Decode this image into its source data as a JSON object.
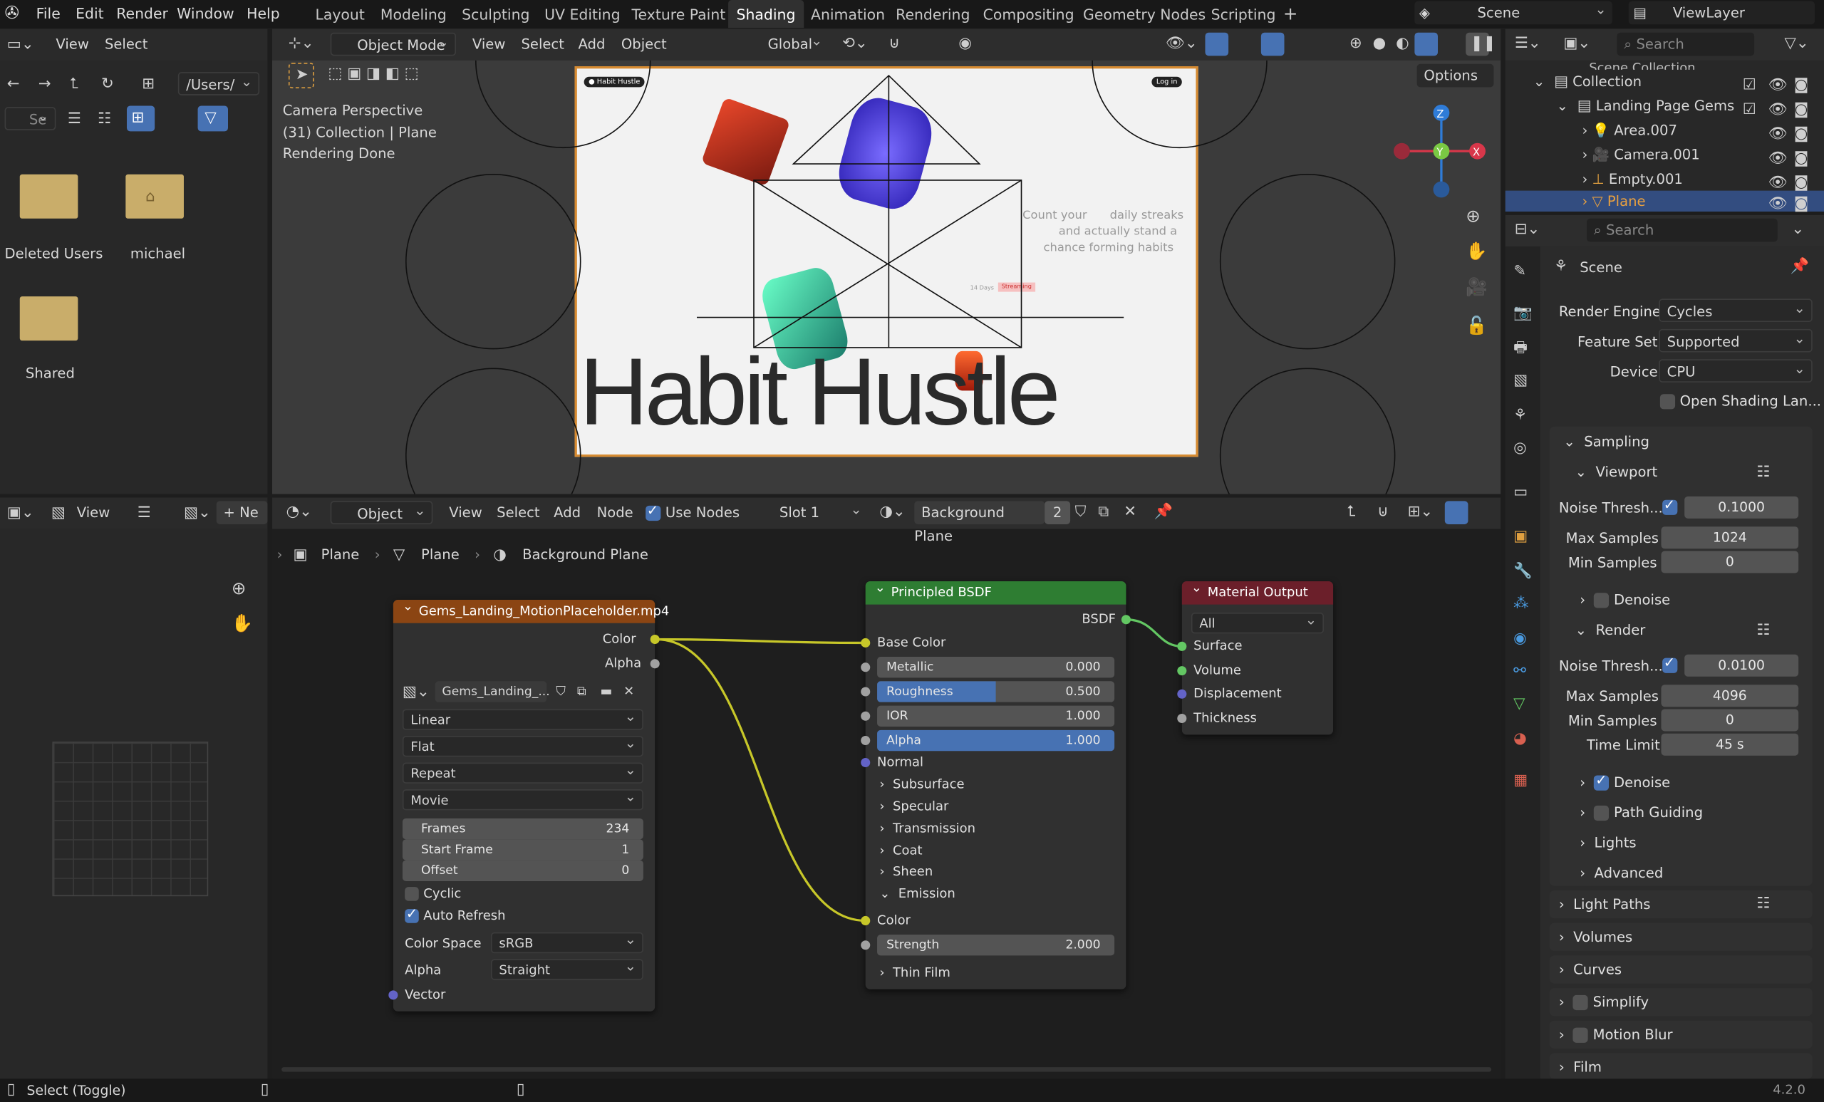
{
  "menu": {
    "file": "File",
    "edit": "Edit",
    "render": "Render",
    "window": "Window",
    "help": "Help"
  },
  "workspaces": [
    "Layout",
    "Modeling",
    "Sculpting",
    "UV Editing",
    "Texture Paint",
    "Shading",
    "Animation",
    "Rendering",
    "Compositing",
    "Geometry Nodes",
    "Scripting",
    "+"
  ],
  "active_workspace": "Shading",
  "scene_name": "Scene",
  "view_layer": "ViewLayer",
  "filebrowser": {
    "view": "View",
    "select": "Select",
    "path": "/Users/",
    "search_placeholder": "Se",
    "items": [
      {
        "name": "Deleted Users"
      },
      {
        "name": "michael"
      },
      {
        "name": "Shared"
      }
    ]
  },
  "viewport": {
    "mode": "Object Mode",
    "view": "View",
    "select": "Select",
    "add": "Add",
    "object": "Object",
    "orientation": "Global",
    "options": "Options",
    "info_line1": "Camera Perspective",
    "info_line2": "(31) Collection | Plane",
    "info_line3": "Rendering Done",
    "render_title": "Habit Hustle",
    "render_tagline_1": "Count your",
    "render_tagline_2": "daily streaks",
    "render_tagline_3": "and actually stand a",
    "render_tagline_4": "chance forming habits",
    "render_badge": "● Habit Hustle",
    "render_login": "Log in",
    "render_pill": "Streaming",
    "render_small": "14 Days",
    "gizmo_z": "Z",
    "gizmo_y": "Y",
    "gizmo_x": "X"
  },
  "image_editor": {
    "view": "View",
    "new": "Ne"
  },
  "node_editor": {
    "object": "Object",
    "view": "View",
    "select": "Select",
    "add": "Add",
    "node": "Node",
    "use_nodes": "Use Nodes",
    "slot": "Slot 1",
    "material": "Background Plane",
    "users": "2",
    "breadcrumb": [
      "Plane",
      "Plane",
      "Background Plane"
    ]
  },
  "image_node": {
    "title": "Gems_Landing_MotionPlaceholder.mp4",
    "out_color": "Color",
    "out_alpha": "Alpha",
    "image_name": "Gems_Landing_...",
    "interpolation": "Linear",
    "projection": "Flat",
    "extension": "Repeat",
    "source": "Movie",
    "frames_label": "Frames",
    "frames": "234",
    "start_label": "Start Frame",
    "start": "1",
    "offset_label": "Offset",
    "offset": "0",
    "cyclic": "Cyclic",
    "auto_refresh": "Auto Refresh",
    "color_space_label": "Color Space",
    "color_space": "sRGB",
    "alpha_label": "Alpha",
    "alpha": "Straight",
    "vector": "Vector"
  },
  "bsdf_node": {
    "title": "Principled BSDF",
    "out": "BSDF",
    "base_color": "Base Color",
    "metallic_label": "Metallic",
    "metallic": "0.000",
    "roughness_label": "Roughness",
    "roughness": "0.500",
    "roughness_fill": 0.5,
    "ior_label": "IOR",
    "ior": "1.000",
    "alpha_label": "Alpha",
    "alpha": "1.000",
    "normal": "Normal",
    "subsurface": "Subsurface",
    "specular": "Specular",
    "transmission": "Transmission",
    "coat": "Coat",
    "sheen": "Sheen",
    "emission": "Emission",
    "emission_color": "Color",
    "strength_label": "Strength",
    "strength": "2.000",
    "thin_film": "Thin Film"
  },
  "output_node": {
    "title": "Material Output",
    "target": "All",
    "surface": "Surface",
    "volume": "Volume",
    "displacement": "Displacement",
    "thickness": "Thickness"
  },
  "outliner": {
    "search": "Search",
    "scene_collection": "Scene Collection",
    "collection": "Collection",
    "landing": "Landing Page Gems",
    "items": [
      {
        "name": "Area.007"
      },
      {
        "name": "Camera.001"
      },
      {
        "name": "Empty.001"
      },
      {
        "name": "Plane"
      }
    ]
  },
  "properties": {
    "search": "Search",
    "scene": "Scene",
    "render_engine_label": "Render Engine",
    "render_engine": "Cycles",
    "feature_set_label": "Feature Set",
    "feature_set": "Supported",
    "device_label": "Device",
    "device": "CPU",
    "osl": "Open Shading Lan...",
    "sampling": "Sampling",
    "viewport": "Viewport",
    "noise_label": "Noise Thresh...",
    "vp_noise": "0.1000",
    "max_samples_label": "Max Samples",
    "vp_max": "1024",
    "min_samples_label": "Min Samples",
    "vp_min": "0",
    "denoise": "Denoise",
    "render": "Render",
    "r_noise": "0.0100",
    "r_max": "4096",
    "r_min": "0",
    "time_limit_label": "Time Limit",
    "time_limit": "45 s",
    "r_denoise": "Denoise",
    "path_guiding": "Path Guiding",
    "lights": "Lights",
    "advanced": "Advanced",
    "light_paths": "Light Paths",
    "volumes": "Volumes",
    "curves": "Curves",
    "simplify": "Simplify",
    "motion_blur": "Motion Blur",
    "film": "Film"
  },
  "status": {
    "left": "Select (Toggle)",
    "version": "4.2.0"
  },
  "colors": {
    "accent": "#4772b3",
    "image_node": "#8b4513",
    "bsdf_node": "#2e7d32",
    "output_node": "#6b1f2a",
    "socket_yellow": "#c7c729",
    "socket_gray": "#a1a1a1",
    "socket_purple": "#6363c7",
    "socket_green": "#63c763"
  }
}
